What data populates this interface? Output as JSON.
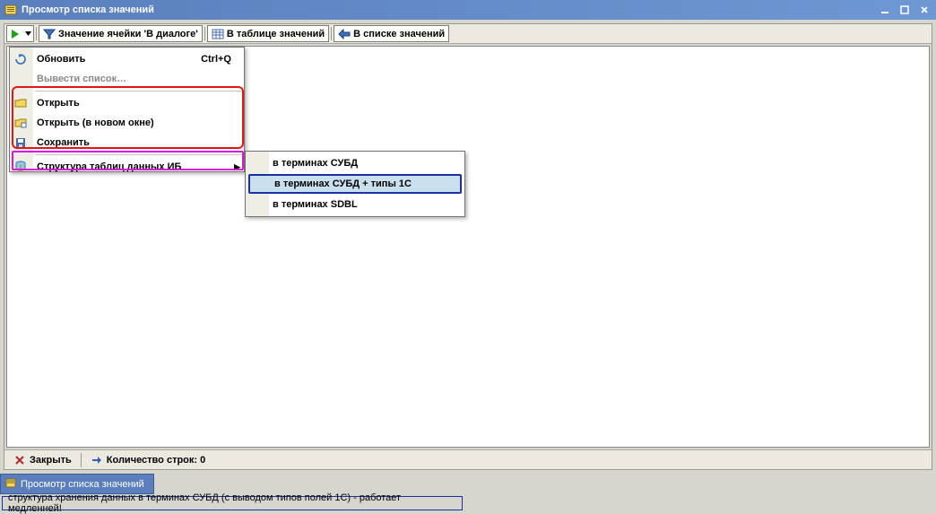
{
  "window": {
    "title": "Просмотр списка значений"
  },
  "win_controls": {
    "min": "_",
    "max": "□",
    "close": "×"
  },
  "toolbar": {
    "cell_value": "Значение ячейки 'В диалоге'",
    "in_table": "В таблице значений",
    "in_list": "В списке значений"
  },
  "main_menu": {
    "refresh": {
      "label": "Обновить",
      "shortcut": "Ctrl+Q"
    },
    "export_list": {
      "label": "Вывести список…"
    },
    "open": {
      "label": "Открыть"
    },
    "open_new": {
      "label": "Открыть (в новом окне)"
    },
    "save": {
      "label": "Сохранить"
    },
    "db_struct": {
      "label": "Структура таблиц данных ИБ"
    }
  },
  "sub_menu": {
    "subd": "в терминах СУБД",
    "subd_1c": "в терминах СУБД + типы 1С",
    "sdbl": "в терминах SDBL"
  },
  "bottom": {
    "close": "Закрыть",
    "rows_prefix": "Количество строк:",
    "rows_count": "0"
  },
  "task_tab": "Просмотр списка значений",
  "status": "структура хранения данных в терминах СУБД (с выводом типов полей 1С) - работает медленней!"
}
